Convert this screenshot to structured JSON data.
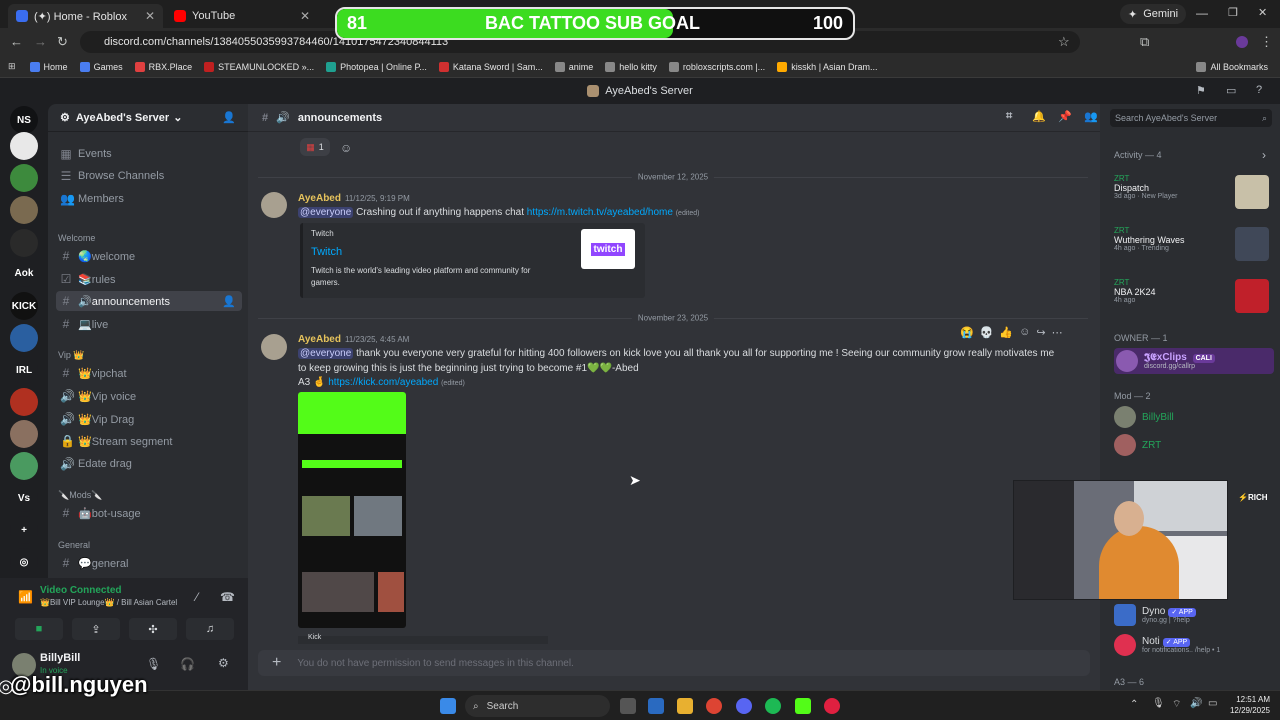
{
  "browser": {
    "tabs": [
      {
        "title": "(✦) Home - Roblox",
        "color": "#3a6df0"
      },
      {
        "title": "YouTube",
        "color": "#ff0000"
      }
    ],
    "gemini_label": "Gemini",
    "url": "discord.com/channels/1384055035993784460/1410175472340844113",
    "bookmarks": [
      {
        "label": "Home",
        "color": "#4a7df0"
      },
      {
        "label": "Games",
        "color": "#4a7df0"
      },
      {
        "label": "RBX.Place",
        "color": "#e04040"
      },
      {
        "label": "STEAMUNLOCKED »...",
        "color": "#c02020"
      },
      {
        "label": "Photopea | Online P...",
        "color": "#1fa090"
      },
      {
        "label": "Katana Sword | Sam...",
        "color": "#d03030"
      },
      {
        "label": "anime",
        "color": "#888888"
      },
      {
        "label": "hello kitty",
        "color": "#888888"
      },
      {
        "label": "robloxscripts.com |...",
        "color": "#888888"
      },
      {
        "label": "kisskh | Asian Dram...",
        "color": "#ffaa00"
      }
    ],
    "all_bookmarks": "All Bookmarks"
  },
  "goal": {
    "current": "81",
    "label": "BAC TATTOO SUB GOAL",
    "target": "100",
    "progress": 0.81
  },
  "discord": {
    "window_title": "AyeAbed's Server",
    "rail": [
      {
        "label": "NS",
        "color": "#111214"
      },
      {
        "label": "",
        "color": "#e8e8e8"
      },
      {
        "label": "",
        "color": "#3d8a3d"
      },
      {
        "label": "",
        "color": "#7a6a50"
      },
      {
        "label": "",
        "color": "#2a2a2a"
      },
      {
        "label": "Aok",
        "color": "#1e1f22"
      },
      {
        "label": "KICK",
        "color": "#111"
      },
      {
        "label": "",
        "color": "#2a5fa0"
      },
      {
        "label": "IRL",
        "color": "#1e1f22"
      },
      {
        "label": "",
        "color": "#b03020"
      },
      {
        "label": "",
        "color": "#8a7060"
      },
      {
        "label": "",
        "color": "#4a9a60"
      },
      {
        "label": "Vs",
        "color": "#1e1f22"
      },
      {
        "label": "+",
        "color": "#1e1f22"
      },
      {
        "label": "◎",
        "color": "#1e1f22"
      }
    ],
    "server_name": "AyeAbed's Server",
    "top_items": [
      "Events",
      "Browse Channels",
      "Members"
    ],
    "categories": {
      "welcome": "Welcome",
      "vip": "Vip 👑",
      "mods": "🔪Mods🔪",
      "general": "General"
    },
    "channels": [
      {
        "glyph": "#",
        "label": "🌏welcome"
      },
      {
        "glyph": "☑",
        "label": "📚rules"
      },
      {
        "glyph": "#",
        "label": "🔊announcements"
      },
      {
        "glyph": "#",
        "label": "💻live"
      },
      {
        "glyph": "#",
        "label": "👑vipchat"
      },
      {
        "glyph": "🔊",
        "label": "👑Vip voice"
      },
      {
        "glyph": "🔊",
        "label": "👑Vip Drag"
      },
      {
        "glyph": "🔒",
        "label": "👑Stream segment"
      },
      {
        "glyph": "🔊",
        "label": "Edate drag"
      },
      {
        "glyph": "#",
        "label": "🤖bot-usage"
      },
      {
        "glyph": "#",
        "label": "💬general"
      }
    ],
    "voice": {
      "status": "Video Connected",
      "location": "👑Bill VIP Lounge👑 / Bill Asian Cartel"
    },
    "user": {
      "name": "BillyBill",
      "status": "In voice"
    },
    "chat": {
      "channel": "announcements",
      "reaction_count": "1",
      "date1": "November 12, 2025",
      "date2": "November 23, 2025",
      "msg1": {
        "author": "AyeAbed",
        "time": "11/12/25, 9:19 PM",
        "mention": "@everyone",
        "text": "Crashing out if anything happens chat",
        "link": "https://m.twitch.tv/ayeabed/home",
        "edited": "(edited)",
        "embed_provider": "Twitch",
        "embed_title": "Twitch",
        "embed_desc1": "Twitch is the world's leading video platform and community for",
        "embed_desc2": "gamers.",
        "embed_logo": "twitch"
      },
      "msg2": {
        "author": "AyeAbed",
        "time": "11/23/25, 4:45 AM",
        "mention": "@everyone",
        "line1": "thank you everyone very grateful for hitting 400 followers on kick love you all thank you all for supporting me ! Seeing our community grow really motivates me",
        "line2": "to keep growing this is just the beginning just trying to become #1💚💚-Abed",
        "line3": "A3 🤞",
        "link": "https://kick.com/ayeabed",
        "edited": "(edited)",
        "kick_label": "Kick"
      },
      "composer_placeholder": "You do not have permission to send messages in this channel."
    },
    "members": {
      "search_placeholder": "Search AyeAbed's Server",
      "activity_header": "Activity — 4",
      "activities": [
        {
          "user": "ZRT",
          "game": "Dispatch",
          "time": "3d ago",
          "tag": "New Player",
          "color": "#c8c0a8"
        },
        {
          "user": "ZRT",
          "game": "Wuthering Waves",
          "time": "4h ago",
          "tag": "Trending",
          "color": "#404858"
        },
        {
          "user": "ZRT",
          "game": "NBA 2K24",
          "time": "4h ago",
          "tag": "",
          "color": "#c0202a"
        }
      ],
      "owner_header": "OWNER — 1",
      "owner": {
        "name": "𝕵𝕰xClips",
        "sub": "discord.gg/callrp",
        "tag": "CALI"
      },
      "mod_header": "Mod — 2",
      "mods": [
        "BillyBill",
        "ZRT"
      ],
      "bots": [
        {
          "name": "Dyno",
          "sub": "dyno.gg | ?help",
          "badge": "✓ APP"
        },
        {
          "name": "Noti",
          "sub": "for notifications.. /help • 1",
          "badge": "✓ APP"
        }
      ],
      "a3_header": "A3 — 6",
      "rich_tag": "RICH"
    }
  },
  "overlay_handle": "@bill.nguyen",
  "taskbar": {
    "search": "Search",
    "time": "12:51 AM",
    "date": "12/29/2025"
  }
}
